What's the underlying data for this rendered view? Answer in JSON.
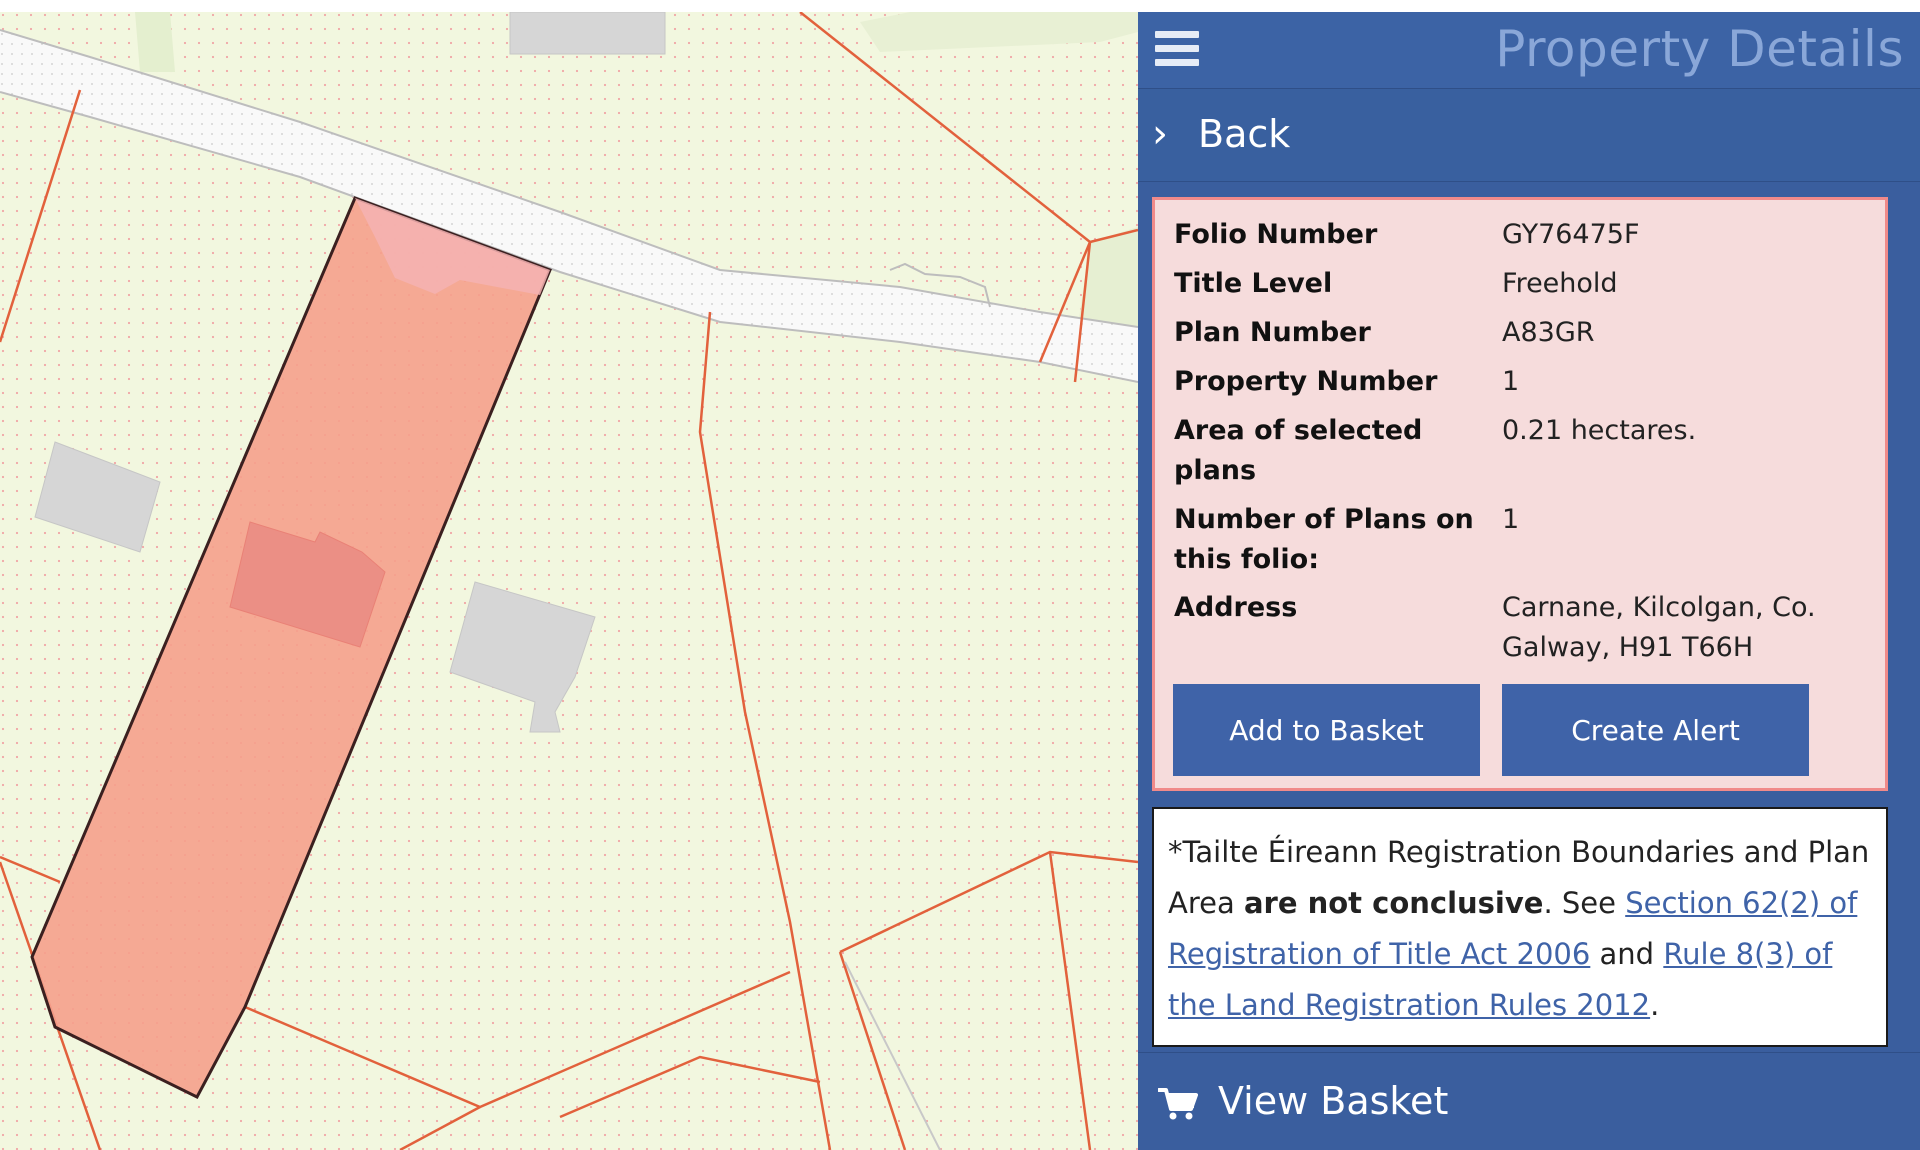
{
  "panel": {
    "title": "Property Details",
    "menu_icon": "hamburger-menu-icon",
    "back_label": "Back",
    "view_basket_label": "View Basket"
  },
  "details": {
    "rows": [
      {
        "label": "Folio Number",
        "value": "GY76475F"
      },
      {
        "label": "Title Level",
        "value": "Freehold"
      },
      {
        "label": "Plan Number",
        "value": "A83GR"
      },
      {
        "label": "Property Number",
        "value": "1"
      },
      {
        "label": "Area of selected plans",
        "value": "0.21 hectares."
      },
      {
        "label": "Number of Plans on this folio:",
        "value": "1"
      },
      {
        "label": "Address",
        "value": "Carnane, Kilcolgan, Co. Galway, H91 T66H"
      }
    ],
    "add_to_basket_label": "Add to Basket",
    "create_alert_label": "Create Alert"
  },
  "disclaimer": {
    "part1": "*Tailte Éireann Registration Boundaries and Plan Area ",
    "bold": "are not conclusive",
    "part2": ". See ",
    "link1": "Section 62(2) of Registration of Title Act 2006",
    "part3": " and ",
    "link2": "Rule 8(3) of the Land Registration Rules 2012",
    "part4": "."
  },
  "colors": {
    "panel_blue": "#3a5e9e",
    "button_blue": "#3f63a8",
    "card_pink": "#f6dcdc",
    "card_border": "#f08a8a",
    "selected_parcel": "#f5a08c",
    "boundary_line": "#e2613c",
    "map_background": "#f2f7df"
  }
}
